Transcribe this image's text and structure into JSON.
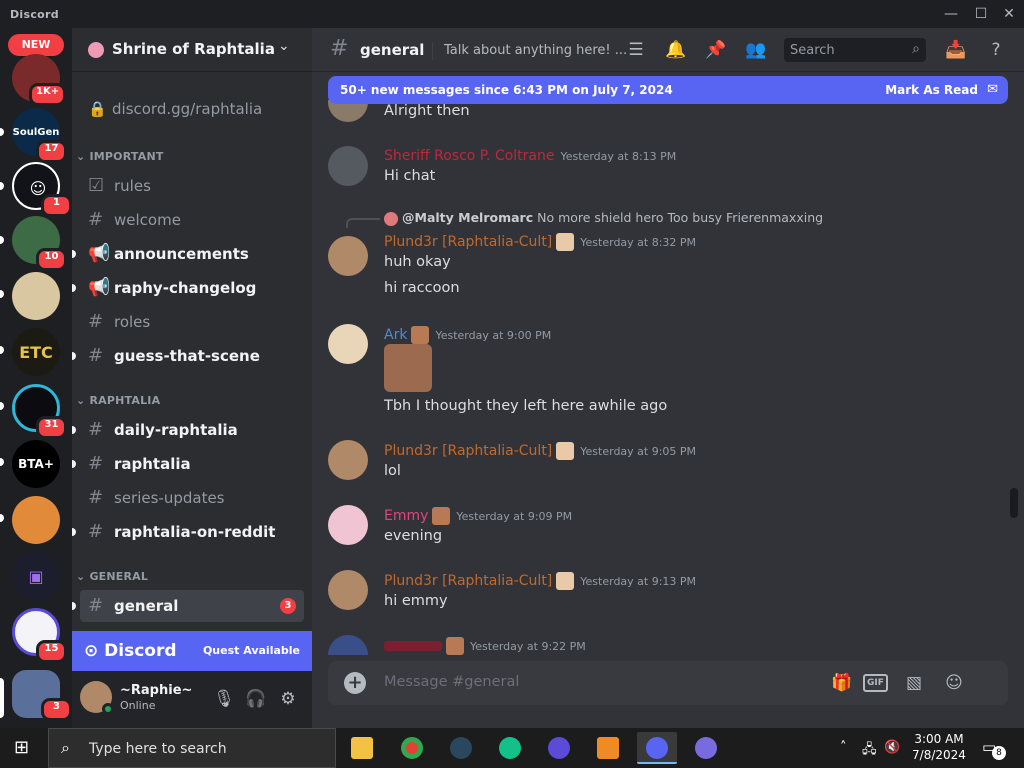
{
  "window": {
    "title": "Discord",
    "minimize": "—",
    "maximize": "☐",
    "close": "✕"
  },
  "guilds": {
    "new_label": "NEW",
    "items": [
      {
        "name": "Server 1",
        "badge": "1K+",
        "color": "#7a2a2a"
      },
      {
        "name": "SoulGen",
        "label": "SoulGen",
        "badge": "17",
        "color": "#0b2a4a"
      },
      {
        "name": "Bot server",
        "badge": "1",
        "color": "#111318"
      },
      {
        "name": "Server 4",
        "badge": "10",
        "color": "#3d6b45"
      },
      {
        "name": "Server 5",
        "badge": "",
        "color": "#d8c7a0"
      },
      {
        "name": "ETC",
        "label": "ETC",
        "badge": "",
        "color": "#1b1b14"
      },
      {
        "name": "Server 7",
        "badge": "31",
        "color": "#0b0b10"
      },
      {
        "name": "BTA+",
        "label": "BTA+",
        "badge": "",
        "color": "#000000"
      },
      {
        "name": "Server 9",
        "badge": "",
        "color": "#e08a3a"
      },
      {
        "name": "Server 10",
        "badge": "",
        "color": "#1c1e2d"
      },
      {
        "name": "Server 11",
        "badge": "15",
        "color": "#f4f4f8"
      },
      {
        "name": "Server 12",
        "badge": "3",
        "color": "#5a6f9a"
      }
    ]
  },
  "server": {
    "name": "Shrine of Raphtalia",
    "invite": "discord.gg/raphtalia"
  },
  "categories": {
    "important": "IMPORTANT",
    "raphtalia": "RAPHTALIA",
    "general": "GENERAL"
  },
  "channels": {
    "rules": "rules",
    "welcome": "welcome",
    "announcements": "announcements",
    "changelog": "raphy-changelog",
    "roles": "roles",
    "guess": "guess-that-scene",
    "daily": "daily-raphtalia",
    "raphtalia": "raphtalia",
    "series": "series-updates",
    "reddit": "raphtalia-on-reddit",
    "general": "general",
    "general_badge": "3"
  },
  "quest": {
    "logo": "Discord",
    "status": "Quest Available"
  },
  "user": {
    "name": "~Raphie~",
    "status": "Online"
  },
  "header": {
    "channel": "general",
    "topic": "Talk about anything here! ...",
    "search_placeholder": "Search"
  },
  "new_messages": {
    "text": "50+ new messages since 6:43 PM on July 7, 2024",
    "action": "Mark As Read"
  },
  "messages": {
    "m0": {
      "line": "Alright then"
    },
    "m1": {
      "author": "Sheriff Rosco P. Coltrane",
      "color": "#c0273d",
      "time": "Yesterday at 8:13 PM",
      "line": "Hi chat"
    },
    "m2": {
      "reply_user": "@Malty Melromarc",
      "reply_text": "No more shield hero  Too busy Frierenmaxxing",
      "author": "Plund3r [Raphtalia-Cult]",
      "color": "#c2692c",
      "time": "Yesterday at 8:32 PM",
      "line1": "huh okay",
      "line2": "hi raccoon"
    },
    "m3": {
      "author": "Ark",
      "color": "#4f8ad8",
      "time": "Yesterday at 9:00 PM",
      "line": "Tbh I thought they left here awhile ago"
    },
    "m4": {
      "author": "Plund3r [Raphtalia-Cult]",
      "color": "#c2692c",
      "time": "Yesterday at 9:05 PM",
      "line": "lol"
    },
    "m5": {
      "author": "Emmy",
      "color": "#e0457b",
      "time": "Yesterday at 9:09 PM",
      "line": "evening"
    },
    "m6": {
      "author": "Plund3r [Raphtalia-Cult]",
      "color": "#c2692c",
      "time": "Yesterday at 9:13 PM",
      "line": "hi emmy"
    },
    "m7": {
      "time": "Yesterday at 9:22 PM"
    }
  },
  "composer": {
    "placeholder": "Message #general",
    "gif": "GIF"
  },
  "taskbar": {
    "search": "Type here to search",
    "time": "3:00 AM",
    "date": "7/8/2024",
    "notifications": "8"
  }
}
